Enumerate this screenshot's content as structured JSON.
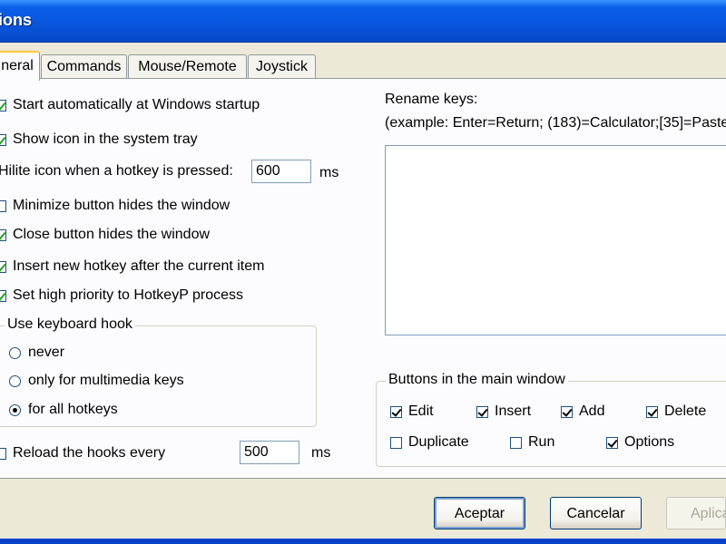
{
  "window": {
    "title": "ions"
  },
  "tabs": [
    {
      "label": "neral",
      "active": true
    },
    {
      "label": "Commands",
      "active": false
    },
    {
      "label": "Mouse/Remote",
      "active": false
    },
    {
      "label": "Joystick",
      "active": false
    }
  ],
  "general": {
    "start_auto": {
      "label": "Start automatically at Windows startup",
      "checked": true
    },
    "show_icon": {
      "label": "Show icon in the system tray",
      "checked": true
    },
    "hilite_label": "Hilite icon when a hotkey is pressed:",
    "hilite_value": "600",
    "hilite_unit": "ms",
    "minimize_hides": {
      "label": "Minimize button hides the window",
      "checked": false
    },
    "close_hides": {
      "label": "Close button hides the window",
      "checked": true
    },
    "insert_after": {
      "label": "Insert new hotkey after the current item",
      "checked": true
    },
    "high_priority": {
      "label": "Set high priority to HotkeyP process",
      "checked": true
    },
    "keyboard_hook": {
      "title": "Use keyboard hook",
      "options": [
        "never",
        "only for multimedia keys",
        "for all hotkeys"
      ],
      "selected": 2
    },
    "reload_hooks": {
      "label": "Reload the hooks every",
      "checked": false
    },
    "reload_value": "500",
    "reload_unit": "ms"
  },
  "rename": {
    "title": "Rename keys:",
    "example": "(example:  Enter=Return; (183)=Calculator;[35]=Paste"
  },
  "buttons_group": {
    "title": "Buttons in the main window",
    "items": [
      {
        "label": "Edit",
        "checked": true
      },
      {
        "label": "Insert",
        "checked": true
      },
      {
        "label": "Add",
        "checked": true
      },
      {
        "label": "Delete",
        "checked": true
      },
      {
        "label": "Duplicate",
        "checked": false
      },
      {
        "label": "Run",
        "checked": false
      },
      {
        "label": "Options",
        "checked": true
      }
    ]
  },
  "footer": {
    "ok": "Aceptar",
    "cancel": "Cancelar",
    "apply": "Aplica"
  },
  "colors": {
    "titlebar": "#0855DD",
    "face": "#ECE9D8",
    "check_green": "#21A121"
  }
}
